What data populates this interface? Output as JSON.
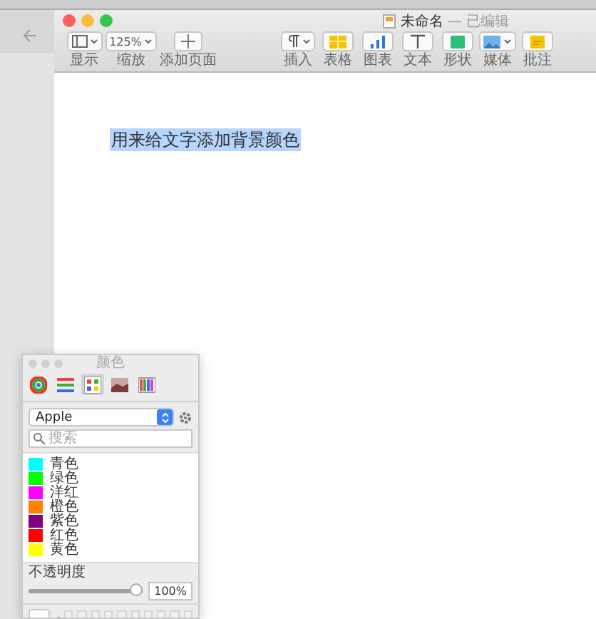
{
  "window": {
    "title": "未命名",
    "status": "— 已编辑"
  },
  "toolbar": [
    {
      "kind": "view",
      "label": "显示"
    },
    {
      "kind": "zoom",
      "label": "缩放",
      "value": "125%"
    },
    {
      "kind": "add",
      "label": "添加页面"
    },
    {
      "kind": "insert",
      "label": "插入"
    },
    {
      "kind": "table",
      "label": "表格"
    },
    {
      "kind": "chart",
      "label": "图表"
    },
    {
      "kind": "text",
      "label": "文本"
    },
    {
      "kind": "shape",
      "label": "形状"
    },
    {
      "kind": "media",
      "label": "媒体"
    },
    {
      "kind": "comment",
      "label": "批注"
    }
  ],
  "document": {
    "text": "用来给文字添加背景颜色",
    "selected": true
  },
  "color_panel": {
    "title": "颜色",
    "modes": [
      {
        "kind": "wheel",
        "selected": false
      },
      {
        "kind": "sliders",
        "selected": false
      },
      {
        "kind": "palettes",
        "selected": true
      },
      {
        "kind": "image",
        "selected": false
      },
      {
        "kind": "pencils",
        "selected": false
      }
    ],
    "palette": "Apple",
    "search": {
      "placeholder": "搜索"
    },
    "colors": [
      {
        "name": "青色",
        "color": "#00ffff"
      },
      {
        "name": "绿色",
        "color": "#00ff00"
      },
      {
        "name": "洋红",
        "color": "#ff00ff"
      },
      {
        "name": "橙色",
        "color": "#ff8000"
      },
      {
        "name": "紫色",
        "color": "#800080"
      },
      {
        "name": "红色",
        "color": "#ff0000"
      },
      {
        "name": "黄色",
        "color": "#ffff00"
      }
    ],
    "opacity": {
      "label": "不透明度",
      "level": 1,
      "reading": "100%"
    }
  }
}
